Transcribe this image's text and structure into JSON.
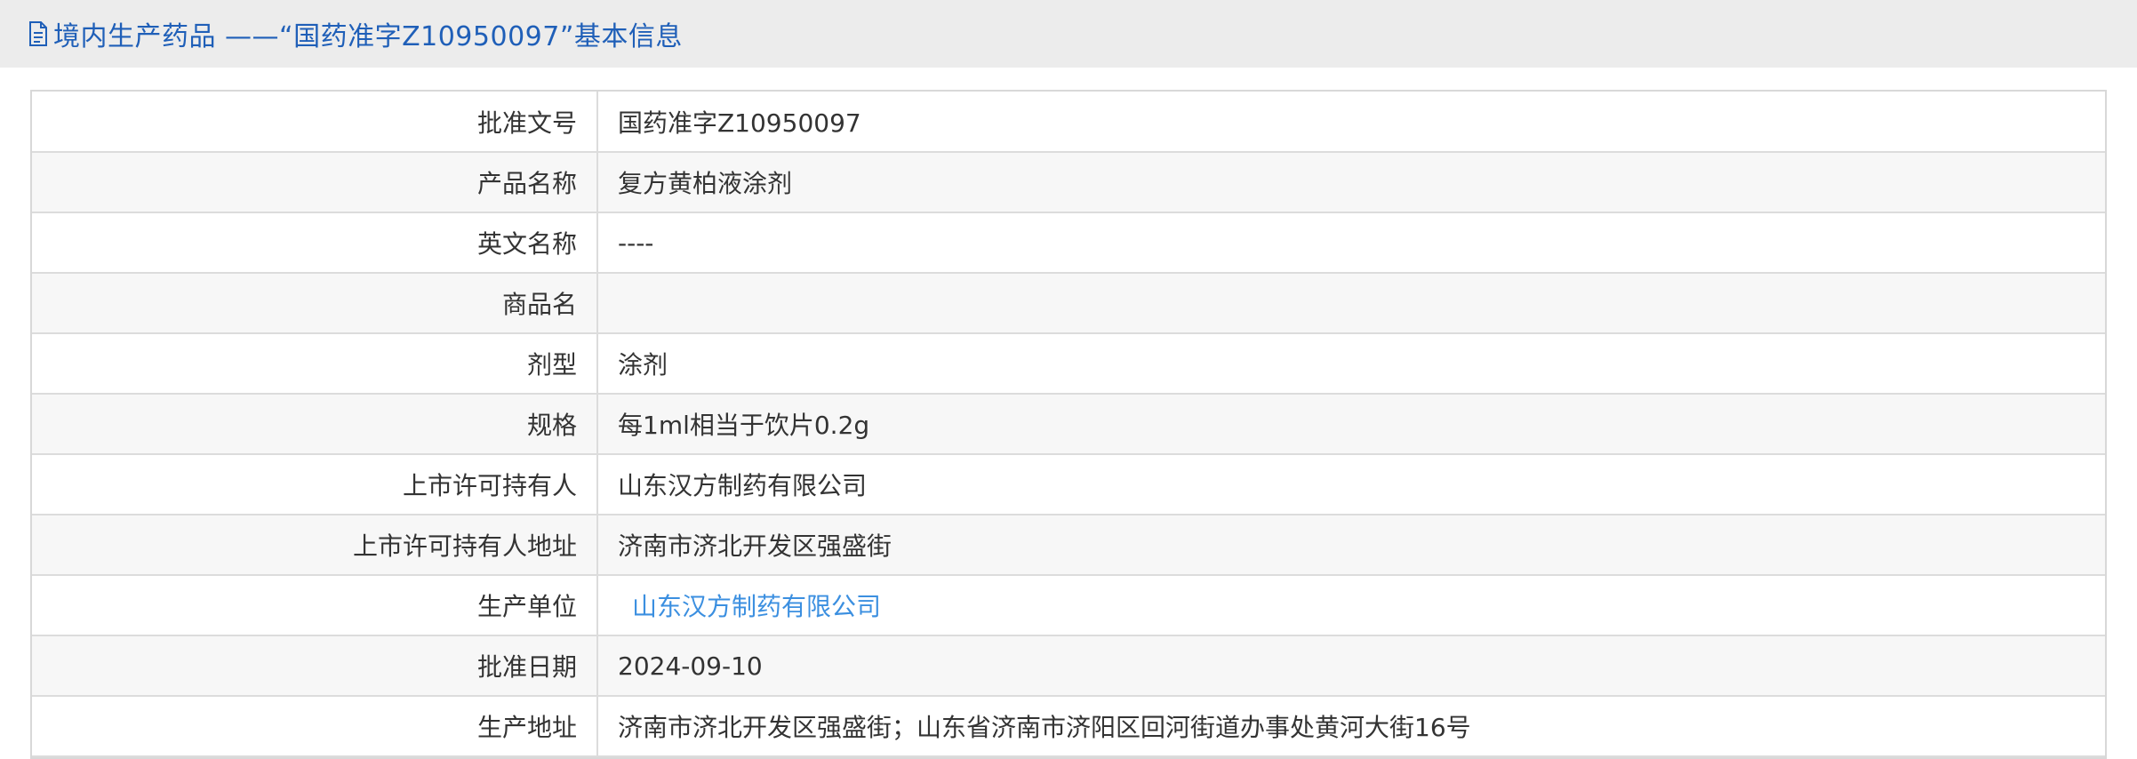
{
  "header": {
    "title": "境内生产药品 ——“国药准字Z10950097”基本信息",
    "icon": "document-icon"
  },
  "rows": [
    {
      "label": "批准文号",
      "value": "国药准字Z10950097"
    },
    {
      "label": "产品名称",
      "value": "复方黄柏液涂剂"
    },
    {
      "label": "英文名称",
      "value": "----"
    },
    {
      "label": "商品名",
      "value": ""
    },
    {
      "label": "剂型",
      "value": "涂剂"
    },
    {
      "label": "规格",
      "value": "每1ml相当于饮片0.2g"
    },
    {
      "label": "上市许可持有人",
      "value": "山东汉方制药有限公司"
    },
    {
      "label": "上市许可持有人地址",
      "value": "济南市济北开发区强盛街"
    },
    {
      "label": "生产单位",
      "value": "山东汉方制药有限公司",
      "is_link": true
    },
    {
      "label": "批准日期",
      "value": "2024-09-10"
    },
    {
      "label": "生产地址",
      "value": "济南市济北开发区强盛街；山东省济南市济阳区回河街道办事处黄河大街16号"
    }
  ],
  "colors": {
    "title": "#1f5fb8",
    "link": "#3b8fe0",
    "header_bg": "#ececec"
  }
}
